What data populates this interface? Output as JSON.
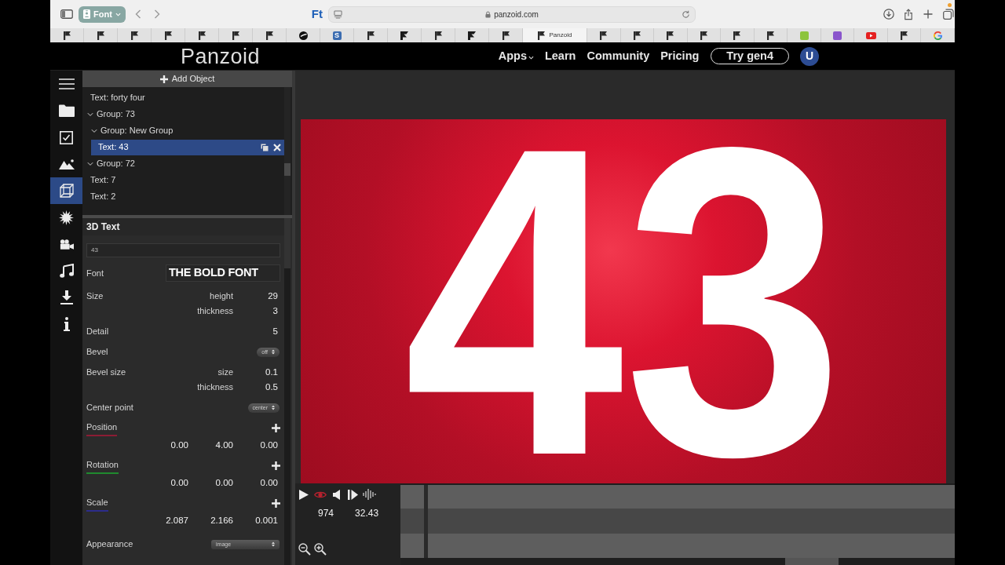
{
  "browser": {
    "tab_group": "Font",
    "site_icon": "Ft",
    "url": "panzoid.com",
    "tabs": [
      {
        "kind": "flag",
        "selected": false
      },
      {
        "kind": "flag",
        "selected": false
      },
      {
        "kind": "flag",
        "selected": false
      },
      {
        "kind": "flag",
        "selected": false
      },
      {
        "kind": "flag",
        "selected": false
      },
      {
        "kind": "flag",
        "selected": false
      },
      {
        "kind": "flag",
        "selected": false
      },
      {
        "kind": "disc",
        "selected": false
      },
      {
        "kind": "letter",
        "letter": "S",
        "color": "#3b6cb0",
        "selected": false
      },
      {
        "kind": "flag",
        "selected": false
      },
      {
        "kind": "notched",
        "selected": false
      },
      {
        "kind": "flag",
        "selected": false
      },
      {
        "kind": "notched",
        "selected": false
      },
      {
        "kind": "flag",
        "selected": false
      },
      {
        "kind": "flag",
        "label": "Panzoid",
        "selected": true
      },
      {
        "kind": "flag",
        "selected": false
      },
      {
        "kind": "flag",
        "selected": false
      },
      {
        "kind": "flag",
        "selected": false
      },
      {
        "kind": "flag",
        "selected": false
      },
      {
        "kind": "flag",
        "selected": false
      },
      {
        "kind": "flag",
        "selected": false
      },
      {
        "kind": "tile",
        "color": "#8cc43c",
        "selected": false
      },
      {
        "kind": "tile",
        "color": "#8a55cc",
        "selected": false
      },
      {
        "kind": "video",
        "selected": false
      },
      {
        "kind": "flag",
        "selected": false
      },
      {
        "kind": "ring",
        "selected": false
      }
    ]
  },
  "site_header": {
    "logo": "Panzoid",
    "nav": [
      {
        "kind": "menu",
        "label": "Apps"
      },
      {
        "kind": "link",
        "label": "Learn"
      },
      {
        "kind": "link",
        "label": "Community"
      },
      {
        "kind": "link",
        "label": "Pricing"
      },
      {
        "kind": "button",
        "label": "Try gen4"
      }
    ],
    "avatar": "U"
  },
  "tool_bar": {
    "items": [
      {
        "kind": "menu",
        "selected": false
      },
      {
        "kind": "folder",
        "selected": false
      },
      {
        "kind": "checklist",
        "selected": false
      },
      {
        "kind": "image",
        "selected": false
      },
      {
        "kind": "cube",
        "selected": true
      },
      {
        "kind": "burst",
        "selected": false
      },
      {
        "kind": "camera",
        "selected": false
      },
      {
        "kind": "music",
        "selected": false
      },
      {
        "kind": "download",
        "selected": false
      },
      {
        "kind": "info",
        "selected": false
      }
    ]
  },
  "object_panel": {
    "add_button": "Add Object",
    "tree": [
      {
        "kind": "text",
        "label": "Text: forty four",
        "selected": false
      },
      {
        "kind": "group",
        "label": "Group: 73",
        "expanded": true,
        "selected": false,
        "children": [
          {
            "kind": "group",
            "label": "Group: New Group",
            "expanded": true,
            "selected": false,
            "children": [
              {
                "kind": "text",
                "label": "Text: 43",
                "selected": true
              }
            ]
          }
        ]
      },
      {
        "kind": "group",
        "label": "Group: 72",
        "expanded": true,
        "selected": false
      },
      {
        "kind": "text",
        "label": "Text: 7",
        "selected": false
      },
      {
        "kind": "text",
        "label": "Text: 2",
        "selected": false
      }
    ]
  },
  "properties": {
    "title": "3D Text",
    "text_value": "43",
    "rows": [
      {
        "kind": "font",
        "label": "Font",
        "value": "THE BOLD FONT"
      },
      {
        "kind": "pairs",
        "label": "Size",
        "fields": [
          {
            "name": "height",
            "value": "29"
          },
          {
            "name": "thickness",
            "value": "3"
          }
        ]
      },
      {
        "kind": "number",
        "label": "Detail",
        "value": "5"
      },
      {
        "kind": "select",
        "label": "Bevel",
        "value": "off"
      },
      {
        "kind": "pairs",
        "label": "Bevel size",
        "fields": [
          {
            "name": "size",
            "value": "0.1"
          },
          {
            "name": "thickness",
            "value": "0.5"
          }
        ]
      },
      {
        "kind": "select",
        "label": "Center point",
        "value": "center"
      },
      {
        "kind": "vector",
        "label": "Position",
        "color": "#8c1c34",
        "values": [
          "0.00",
          "4.00",
          "0.00"
        ]
      },
      {
        "kind": "vector",
        "label": "Rotation",
        "color": "#1f8a2e",
        "values": [
          "0.00",
          "0.00",
          "0.00"
        ]
      },
      {
        "kind": "vector",
        "label": "Scale",
        "color": "#2c2c8c",
        "values": [
          "2.087",
          "2.166",
          "0.001"
        ]
      },
      {
        "kind": "longselect",
        "label": "Appearance",
        "value": "image"
      }
    ]
  },
  "preview": {
    "text": "43"
  },
  "timeline": {
    "frame": "974",
    "time": "32.43"
  }
}
